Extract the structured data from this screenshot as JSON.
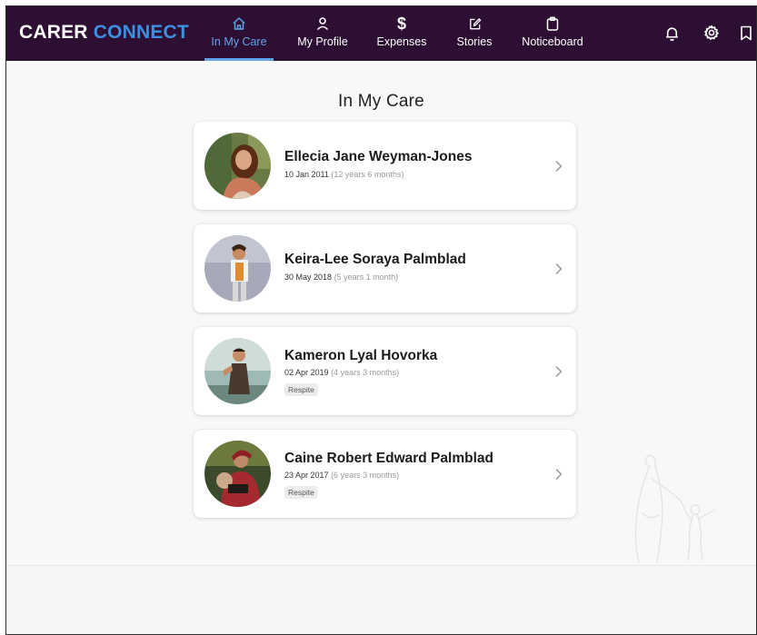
{
  "app": {
    "brand_part1": "CARER ",
    "brand_part2": "CONNECT"
  },
  "nav": {
    "items": [
      {
        "label": "In My Care",
        "icon": "home-icon",
        "active": true
      },
      {
        "label": "My Profile",
        "icon": "person-icon",
        "active": false
      },
      {
        "label": "Expenses",
        "icon": "dollar-icon",
        "active": false
      },
      {
        "label": "Stories",
        "icon": "edit-icon",
        "active": false
      },
      {
        "label": "Noticeboard",
        "icon": "clipboard-icon",
        "active": false
      }
    ],
    "right_icons": [
      "bell-icon",
      "gear-icon",
      "bookmark-icon"
    ]
  },
  "page": {
    "title": "In My Care"
  },
  "children": [
    {
      "name": "Ellecia Jane Weyman-Jones",
      "dob": "10 Jan 2011",
      "age": "(12 years 6 months)",
      "badge": ""
    },
    {
      "name": "Keira-Lee Soraya Palmblad",
      "dob": "30 May 2018",
      "age": "(5 years 1 month)",
      "badge": ""
    },
    {
      "name": "Kameron Lyal Hovorka",
      "dob": "02 Apr 2019",
      "age": "(4 years 3 months)",
      "badge": "Respite"
    },
    {
      "name": "Caine Robert Edward Palmblad",
      "dob": "23 Apr 2017",
      "age": "(6 years 3 months)",
      "badge": "Respite"
    }
  ],
  "colors": {
    "navbar_bg": "#2d0f33",
    "accent": "#5fa4e8",
    "brand_blue": "#3f8fe0"
  }
}
